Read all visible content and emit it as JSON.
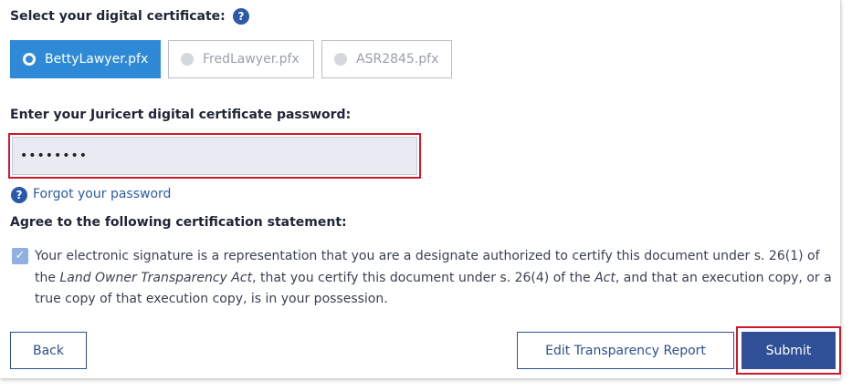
{
  "certificate": {
    "label": "Select your digital certificate:",
    "help_icon": "?",
    "options": [
      {
        "name": "BettyLawyer.pfx",
        "selected": true
      },
      {
        "name": "FredLawyer.pfx",
        "selected": false
      },
      {
        "name": "ASR2845.pfx",
        "selected": false
      }
    ]
  },
  "password": {
    "label": "Enter your Juricert digital certificate password:",
    "value": "••••••••",
    "forgot_icon": "?",
    "forgot_label": "Forgot your password"
  },
  "certification": {
    "label": "Agree to the following certification statement:",
    "checked": true,
    "checkmark": "✓",
    "statement_part1": "Your electronic signature is a representation that you are a designate authorized to certify this document under s. 26(1) of the ",
    "statement_act1": "Land Owner Transparency Act",
    "statement_part2": ", that you certify this document under s. 26(4) of the ",
    "statement_act2": "Act",
    "statement_part3": ", and that an execution copy, or a true copy of that execution copy, is in your possession."
  },
  "buttons": {
    "back": "Back",
    "edit": "Edit Transparency Report",
    "submit": "Submit"
  },
  "colors": {
    "accent": "#2e8ad6",
    "primary": "#2f4f96",
    "highlight": "#d0192b"
  }
}
